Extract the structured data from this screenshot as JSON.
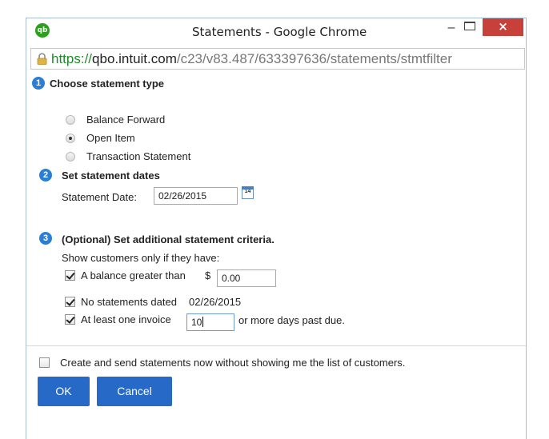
{
  "window": {
    "title": "Statements - Google Chrome",
    "app_logo_text": "qb",
    "minimize_label": "–",
    "close_label": "×"
  },
  "address": {
    "scheme": "https://",
    "host": "qbo.intuit.com",
    "path": "/c23/v83.487/633397636/statements/stmtfilter"
  },
  "step1": {
    "number": "1",
    "title": "Choose statement type",
    "options": [
      {
        "label": "Balance Forward",
        "checked": false
      },
      {
        "label": "Open Item",
        "checked": true
      },
      {
        "label": "Transaction Statement",
        "checked": false
      }
    ]
  },
  "step2": {
    "number": "2",
    "title": "Set statement dates",
    "date_label": "Statement Date:",
    "date_value": "02/26/2015",
    "calendar_icon_text": "14"
  },
  "step3": {
    "number": "3",
    "title": "(Optional) Set additional statement criteria.",
    "subtitle": "Show customers only if they have:",
    "balance_label": "A balance greater than",
    "currency_symbol": "$",
    "balance_value": "0.00",
    "no_statements_label": "No statements dated",
    "no_statements_date": "02/26/2015",
    "invoice_label": "At least one invoice",
    "invoice_days": "10",
    "invoice_suffix": "or more days past due."
  },
  "send_now_label": "Create and send statements now without showing me the list of customers.",
  "buttons": {
    "ok": "OK",
    "cancel": "Cancel"
  },
  "colors": {
    "accent": "#2769c7",
    "step_badge": "#2a7fd4",
    "close_button": "#c7403a",
    "secure_scheme": "#1f8b2a"
  }
}
